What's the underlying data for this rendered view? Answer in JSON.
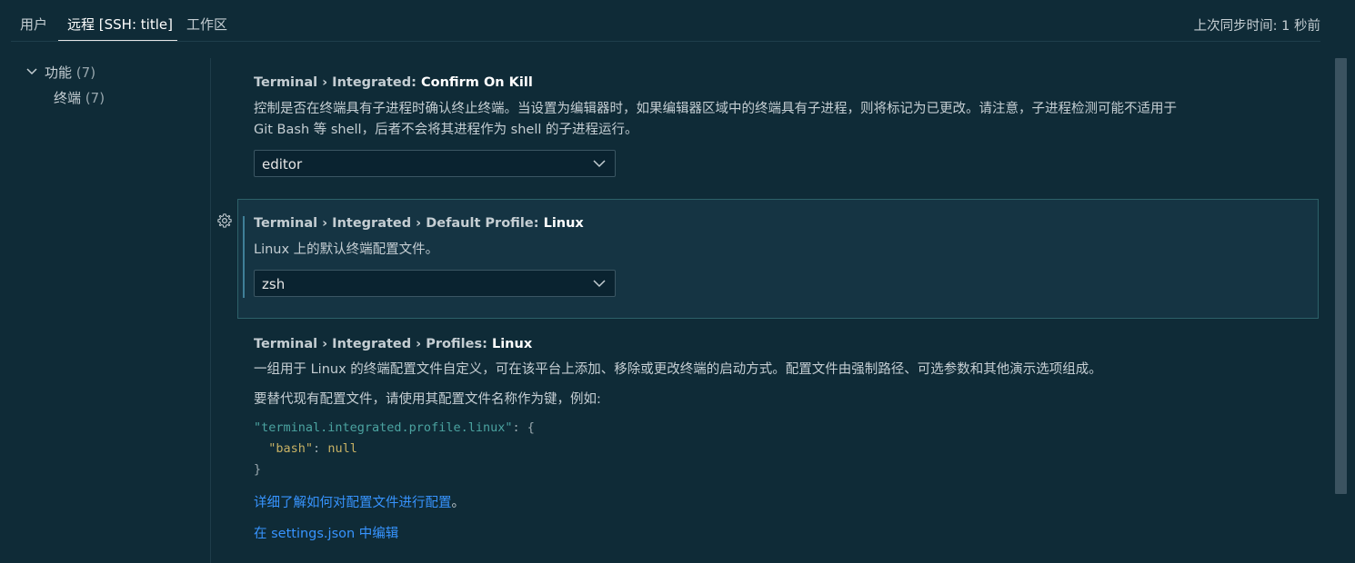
{
  "tabs": [
    {
      "label": "用户"
    },
    {
      "label": "远程 [SSH: title]",
      "active": true
    },
    {
      "label": "工作区"
    }
  ],
  "sync_status": "上次同步时间: 1 秒前",
  "toc": {
    "items": [
      {
        "label": "功能",
        "count": "(7)",
        "expanded": true
      },
      {
        "label": "终端",
        "count": "(7)"
      }
    ]
  },
  "settings": {
    "confirm_on_kill": {
      "prefix": "Terminal › Integrated: ",
      "key": "Confirm On Kill",
      "description_line1": "控制是否在终端具有子进程时确认终止终端。当设置为编辑器时，如果编辑器区域中的终端具有子进程，则将标记为已更改。请注意，子进程检测可能不适用于",
      "description_line2": "Git Bash 等 shell，后者不会将其进程作为 shell 的子进程运行。",
      "value": "editor"
    },
    "default_profile_linux": {
      "prefix": "Terminal › Integrated › Default Profile: ",
      "key": "Linux",
      "description": "Linux 上的默认终端配置文件。",
      "value": "zsh"
    },
    "profiles_linux": {
      "prefix": "Terminal › Integrated › Profiles: ",
      "key": "Linux",
      "description_line1": "一组用于 Linux 的终端配置文件自定义，可在该平台上添加、移除或更改终端的启动方式。配置文件由强制路径、可选参数和其他演示选项组成。",
      "description_line2": "要替代现有配置文件，请使用其配置文件名称作为键，例如:",
      "code": {
        "line1_key": "\"terminal.integrated.profile.linux\"",
        "line1_rest": ": {",
        "line2_key": "\"bash\"",
        "line2_sep": ": ",
        "line2_val": "null",
        "line3": "}"
      },
      "learn_more_link": "详细了解如何对配置文件进行配置",
      "learn_more_suffix": "。",
      "edit_link": "在 settings.json 中编辑"
    }
  },
  "colors": {
    "background": "#0f2b37",
    "focused_row": "#153443",
    "link": "#3794ff",
    "code_key": "#4ba3a0",
    "code_value": "#c7b164"
  }
}
